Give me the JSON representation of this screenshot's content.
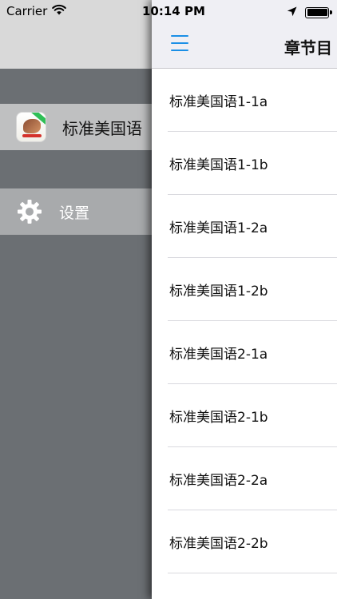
{
  "status_bar": {
    "carrier": "Carrier",
    "time": "10:14 PM"
  },
  "drawer": {
    "app_name": "标准美国语",
    "settings_label": "设置"
  },
  "navbar": {
    "title": "章节目"
  },
  "chapters": [
    {
      "label": "标准美国语1-1a"
    },
    {
      "label": "标准美国语1-1b"
    },
    {
      "label": "标准美国语1-2a"
    },
    {
      "label": "标准美国语1-2b"
    },
    {
      "label": "标准美国语2-1a"
    },
    {
      "label": "标准美国语2-1b"
    },
    {
      "label": "标准美国语2-2a"
    },
    {
      "label": "标准美国语2-2b"
    }
  ],
  "colors": {
    "accent": "#1a8fe6",
    "drawer_background": "#6b6f73"
  },
  "icons": {
    "menu": "hamburger-menu-icon",
    "settings": "gear-icon",
    "location": "location-arrow-icon",
    "wifi": "wifi-icon",
    "battery": "battery-icon"
  }
}
